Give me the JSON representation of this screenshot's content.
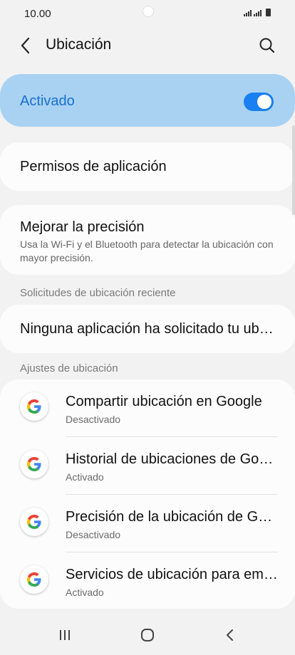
{
  "status": {
    "time": "10.00"
  },
  "app_bar": {
    "title": "Ubicación",
    "back_icon": "chevron-left-icon",
    "search_icon": "search-icon"
  },
  "master_toggle": {
    "label": "Activado",
    "state": "on"
  },
  "app_permissions": {
    "title": "Permisos de aplicación"
  },
  "improve_accuracy": {
    "title": "Mejorar la precisión",
    "subtitle": "Usa la Wi-Fi y el Bluetooth para detectar la ubicación con mayor precisión."
  },
  "recent_requests": {
    "header": "Solicitudes de ubicación reciente",
    "item": "Ninguna aplicación ha solicitado tu ub…"
  },
  "location_settings": {
    "header": "Ajustes de ubicación",
    "items": [
      {
        "title": "Compartir ubicación en Google",
        "status": "Desactivado"
      },
      {
        "title": "Historial de ubicaciones de Go…",
        "status": "Activado"
      },
      {
        "title": "Precisión de la ubicación de G…",
        "status": "Desactivado"
      },
      {
        "title": "Servicios de ubicación para em…",
        "status": "Activado"
      }
    ]
  },
  "colors": {
    "accent": "#1a7ff0",
    "toggle_bg": "#a9d2f2",
    "background": "#f2f2f2"
  }
}
